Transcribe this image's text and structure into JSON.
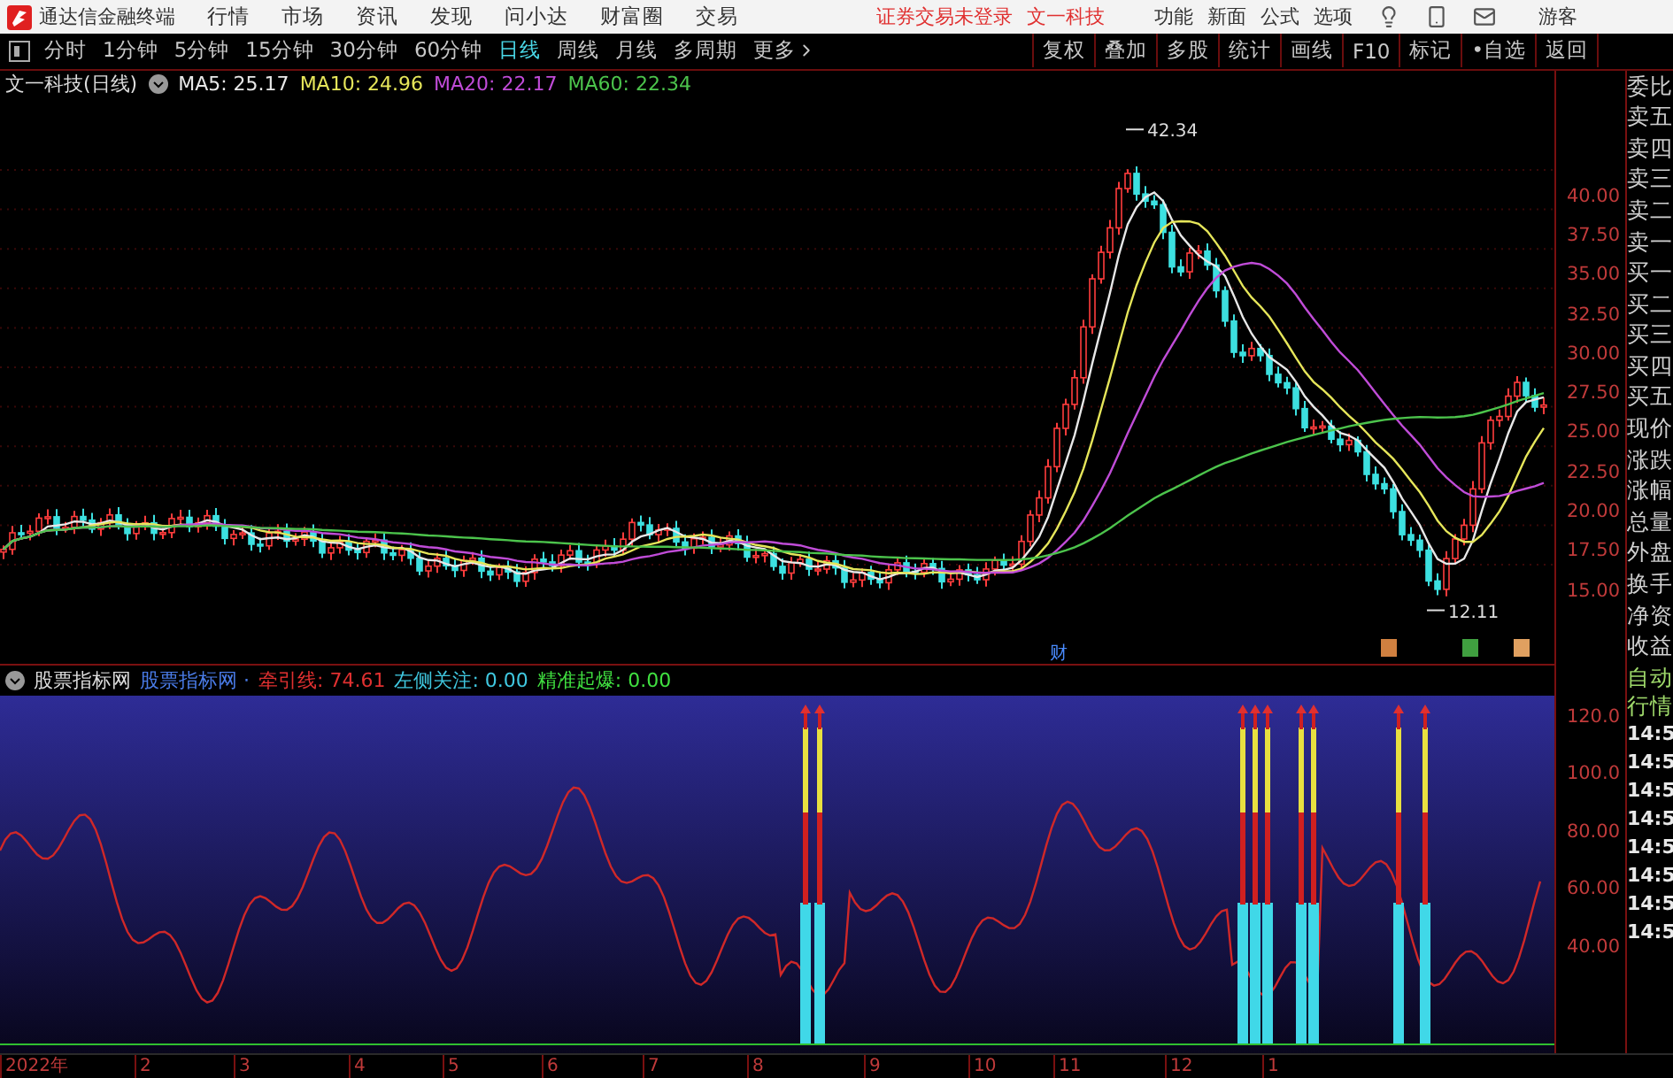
{
  "title_bar": {
    "app_name": "通达信金融终端",
    "menu": [
      "行情",
      "市场",
      "资讯",
      "发现",
      "问小达",
      "财富圈",
      "交易"
    ],
    "login_status": "证券交易未登录",
    "stock_name": "文一科技",
    "tools": [
      "功能",
      "新面",
      "公式",
      "选项"
    ],
    "user": "游客"
  },
  "period_tabs": [
    {
      "label": "分时",
      "selected": false
    },
    {
      "label": "1分钟",
      "selected": false
    },
    {
      "label": "5分钟",
      "selected": false
    },
    {
      "label": "15分钟",
      "selected": false
    },
    {
      "label": "30分钟",
      "selected": false
    },
    {
      "label": "60分钟",
      "selected": false
    },
    {
      "label": "日线",
      "selected": true
    },
    {
      "label": "周线",
      "selected": false
    },
    {
      "label": "月线",
      "selected": false
    },
    {
      "label": "多周期",
      "selected": false
    },
    {
      "label": "更多",
      "selected": false
    }
  ],
  "toolbar_buttons": [
    "复权",
    "叠加",
    "多股",
    "统计",
    "画线",
    "F10",
    "标记",
    "•自选",
    "返回"
  ],
  "chart_header": {
    "title": "文一科技(日线)",
    "indicators": [
      {
        "label": "MA5: 25.17",
        "color": "#e8e8e8"
      },
      {
        "label": "MA10: 24.96",
        "color": "#e6e65a"
      },
      {
        "label": "MA20: 22.17",
        "color": "#c04cd8"
      },
      {
        "label": "MA60: 22.34",
        "color": "#4cc44c"
      }
    ]
  },
  "price_axis": [
    "40.00",
    "37.50",
    "35.00",
    "32.50",
    "30.00",
    "27.50",
    "25.00",
    "22.50",
    "20.00",
    "17.50",
    "15.00"
  ],
  "price_annotations": {
    "high": "42.34",
    "low": "12.11",
    "event_marker": "财"
  },
  "quote_panel": [
    "委比",
    "卖五",
    "卖四",
    "卖三",
    "卖二",
    "卖一",
    "买一",
    "买二",
    "买三",
    "买四",
    "买五",
    "现价",
    "涨跌",
    "涨幅",
    "总量",
    "外盘",
    "换手",
    "净资",
    "收益"
  ],
  "indicator_header": {
    "name": "股票指标网",
    "formula": "股票指标网 ·",
    "values": [
      {
        "label": "牵引线: 74.61",
        "color": "#e03030"
      },
      {
        "label": "左侧关注: 0.00",
        "color": "#40c8e0"
      },
      {
        "label": "精准起爆: 0.00",
        "color": "#40e040"
      }
    ]
  },
  "indicator_axis": [
    "120.0",
    "100.0",
    "80.00",
    "60.00",
    "40.00"
  ],
  "side_panel": {
    "mode": "自动行情",
    "times": [
      "14:5",
      "14:5",
      "14:5",
      "14:5",
      "14:5",
      "14:5",
      "14:5",
      "14:5"
    ]
  },
  "date_axis": [
    "2022年",
    "2",
    "3",
    "4",
    "5",
    "6",
    "7",
    "8",
    "9",
    "10",
    "11",
    "12",
    "1"
  ]
}
